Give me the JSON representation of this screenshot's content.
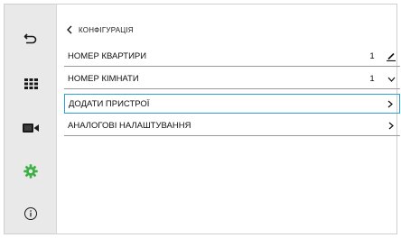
{
  "header": {
    "title": "КОНФІГУРАЦІЯ"
  },
  "sidebar": {
    "items": [
      {
        "icon": "return-icon",
        "color": "#1a1a1a"
      },
      {
        "icon": "grid-icon",
        "color": "#1a1a1a"
      },
      {
        "icon": "camera-icon",
        "color": "#1a1a1a"
      },
      {
        "icon": "gear-icon",
        "color": "#3cb043"
      },
      {
        "icon": "info-icon",
        "color": "#1a1a1a"
      }
    ]
  },
  "settings": {
    "rows": [
      {
        "label": "НОМЕР КВАРТИРИ",
        "value": "1",
        "trail_icon": "edit-icon"
      },
      {
        "label": "НОМЕР КІМНАТИ",
        "value": "1",
        "trail_icon": "chevron-down-icon"
      },
      {
        "label": "ДОДАТИ ПРИСТРОЇ",
        "value": "",
        "trail_icon": "chevron-right-icon",
        "selected": true
      },
      {
        "label": "АНАЛОГОВІ НАЛАШТУВАННЯ",
        "value": "",
        "trail_icon": "chevron-right-icon"
      }
    ]
  },
  "colors": {
    "accent": "#2ea0d8",
    "active_icon": "#3cb043",
    "sidebar_bg": "#e9e9e9"
  }
}
